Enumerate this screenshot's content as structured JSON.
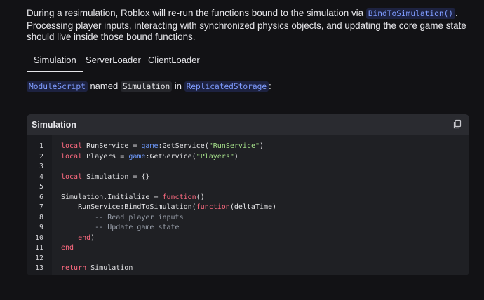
{
  "intro": {
    "before": "During a resimulation, Roblox will re-run the functions bound to the simulation via ",
    "code": "BindToSimulation()",
    "after": ". Processing player inputs, interacting with synchronized physics objects, and updating the core game state should live inside those bound functions."
  },
  "tabs": [
    {
      "label": "Simulation",
      "active": true
    },
    {
      "label": "ServerLoader",
      "active": false
    },
    {
      "label": "ClientLoader",
      "active": false
    }
  ],
  "module_line": {
    "type": "ModuleScript",
    "named": "named",
    "name": "Simulation",
    "in": "in",
    "location": "ReplicatedStorage",
    "colon": ":"
  },
  "codeblock": {
    "title": "Simulation",
    "copy_icon": "copy-icon",
    "line_numbers": [
      "1",
      "2",
      "3",
      "4",
      "5",
      "6",
      "7",
      "8",
      "9",
      "10",
      "11",
      "12",
      "13"
    ]
  }
}
